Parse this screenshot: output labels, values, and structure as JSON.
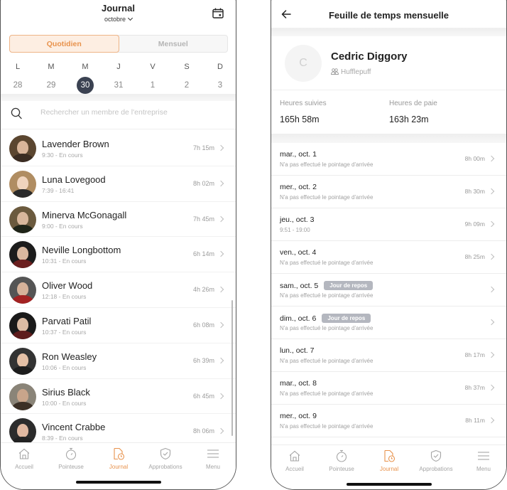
{
  "colors": {
    "accent": "#e8924c",
    "selected_day": "#3b4252",
    "badge": "#b4b7bf"
  },
  "left": {
    "header": {
      "title": "Journal",
      "month": "octobre",
      "calendar_icon": "calendar-icon"
    },
    "segments": [
      {
        "label": "Quotidien",
        "active": true
      },
      {
        "label": "Mensuel",
        "active": false
      }
    ],
    "week": [
      {
        "letter": "L",
        "num": "28"
      },
      {
        "letter": "M",
        "num": "29"
      },
      {
        "letter": "M",
        "num": "30",
        "selected": true
      },
      {
        "letter": "J",
        "num": "31"
      },
      {
        "letter": "V",
        "num": "1"
      },
      {
        "letter": "S",
        "num": "2"
      },
      {
        "letter": "D",
        "num": "3"
      }
    ],
    "search": {
      "placeholder": "Rechercher un membre de l'entreprise"
    },
    "members": [
      {
        "name": "Lavender Brown",
        "sub": "9:30 - En cours",
        "duration": "7h 15m"
      },
      {
        "name": "Luna Lovegood",
        "sub": "7:39 - 16:41",
        "duration": "8h 02m"
      },
      {
        "name": "Minerva McGonagall",
        "sub": "9:00 - En cours",
        "duration": "7h 45m"
      },
      {
        "name": "Neville Longbottom",
        "sub": "10:31 - En cours",
        "duration": "6h 14m"
      },
      {
        "name": "Oliver Wood",
        "sub": "12:18 - En cours",
        "duration": "4h 26m"
      },
      {
        "name": "Parvati Patil",
        "sub": "10:37 - En cours",
        "duration": "6h 08m"
      },
      {
        "name": "Ron Weasley",
        "sub": "10:06 - En cours",
        "duration": "6h 39m"
      },
      {
        "name": "Sirius Black",
        "sub": "10:00 - En cours",
        "duration": "6h 45m"
      },
      {
        "name": "Vincent Crabbe",
        "sub": "8:39 - En cours",
        "duration": "8h 06m"
      }
    ]
  },
  "tabbar": {
    "items": [
      {
        "label": "Accueil",
        "icon": "home-icon"
      },
      {
        "label": "Pointeuse",
        "icon": "stopwatch-icon"
      },
      {
        "label": "Journal",
        "icon": "journal-icon",
        "active": true
      },
      {
        "label": "Approbations",
        "icon": "shield-check-icon"
      },
      {
        "label": "Menu",
        "icon": "menu-icon"
      }
    ]
  },
  "right": {
    "header": {
      "title": "Feuille de temps mensuelle"
    },
    "profile": {
      "initial": "C",
      "name": "Cedric Diggory",
      "team": "Hufflepuff"
    },
    "stats": [
      {
        "label": "Heures suivies",
        "value": "165h 58m"
      },
      {
        "label": "Heures de paie",
        "value": "163h 23m"
      }
    ],
    "days": [
      {
        "date": "mar., oct. 1",
        "sub": "N'a pas effectué le pointage d'arrivée",
        "duration": "8h 00m",
        "badge": ""
      },
      {
        "date": "mer., oct. 2",
        "sub": "N'a pas effectué le pointage d'arrivée",
        "duration": "8h 30m",
        "badge": ""
      },
      {
        "date": "jeu., oct. 3",
        "sub": "9:51 - 19:00",
        "duration": "9h 09m",
        "badge": ""
      },
      {
        "date": "ven., oct. 4",
        "sub": "N'a pas effectué le pointage d'arrivée",
        "duration": "8h 25m",
        "badge": ""
      },
      {
        "date": "sam., oct. 5",
        "sub": "N'a pas effectué le pointage d'arrivée",
        "duration": "",
        "badge": "Jour de repos"
      },
      {
        "date": "dim., oct. 6",
        "sub": "N'a pas effectué le pointage d'arrivée",
        "duration": "",
        "badge": "Jour de repos"
      },
      {
        "date": "lun., oct. 7",
        "sub": "N'a pas effectué le pointage d'arrivée",
        "duration": "8h 17m",
        "badge": ""
      },
      {
        "date": "mar., oct. 8",
        "sub": "N'a pas effectué le pointage d'arrivée",
        "duration": "8h 37m",
        "badge": ""
      },
      {
        "date": "mer., oct. 9",
        "sub": "N'a pas effectué le pointage d'arrivée",
        "duration": "8h 11m",
        "badge": ""
      }
    ]
  }
}
